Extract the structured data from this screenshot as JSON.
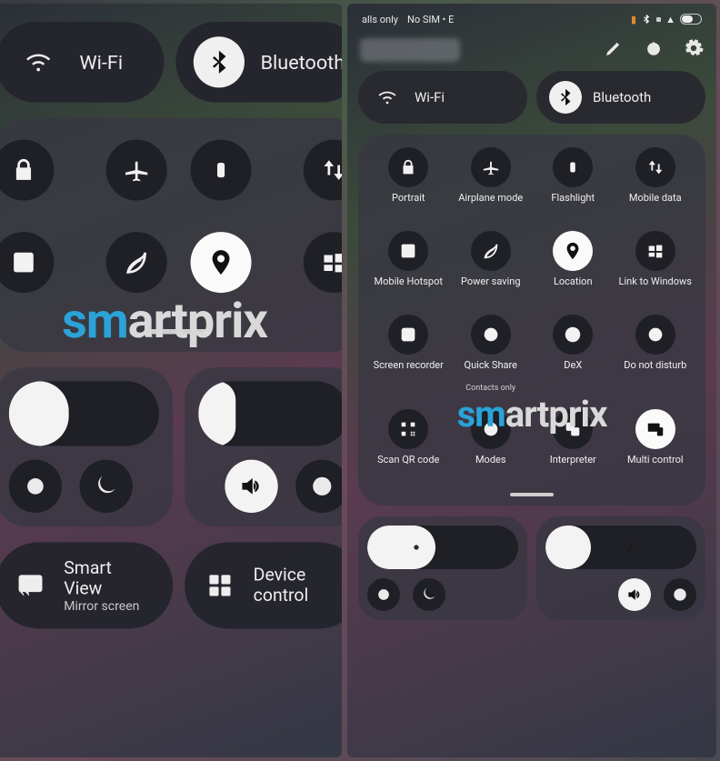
{
  "watermark": "smartprix",
  "left": {
    "wifi_label": "Wi-Fi",
    "bluetooth_label": "Bluetooth",
    "smartview_title": "Smart View",
    "smartview_sub": "Mirror screen",
    "device_control_label": "Device control",
    "brightness_pct": 40,
    "volume_pct": 25
  },
  "right": {
    "status_left_1": "alls only",
    "status_left_2": "No SIM • E",
    "wifi_label": "Wi-Fi",
    "bluetooth_label": "Bluetooth",
    "tiles": [
      {
        "id": "portrait",
        "label": "Portrait",
        "on": false
      },
      {
        "id": "airplane",
        "label": "Airplane mode",
        "on": false
      },
      {
        "id": "flashlight",
        "label": "Flashlight",
        "on": false
      },
      {
        "id": "mobiledata",
        "label": "Mobile data",
        "on": false
      },
      {
        "id": "hotspot",
        "label": "Mobile Hotspot",
        "on": false
      },
      {
        "id": "powersaving",
        "label": "Power saving",
        "on": false
      },
      {
        "id": "location",
        "label": "Location",
        "on": true
      },
      {
        "id": "linkwindows",
        "label": "Link to Windows",
        "on": false
      },
      {
        "id": "screenrec",
        "label": "Screen recorder",
        "on": false
      },
      {
        "id": "quickshare",
        "label": "Quick Share",
        "on": false,
        "sub": "Contacts only"
      },
      {
        "id": "dex",
        "label": "DeX",
        "on": false
      },
      {
        "id": "dnd",
        "label": "Do not disturb",
        "on": false
      },
      {
        "id": "qr",
        "label": "Scan QR code",
        "on": false
      },
      {
        "id": "modes",
        "label": "Modes",
        "on": false
      },
      {
        "id": "interpreter",
        "label": "Interpreter",
        "on": false
      },
      {
        "id": "multicontrol",
        "label": "Multi control",
        "on": true
      }
    ],
    "brightness_pct": 45,
    "volume_pct": 30
  }
}
